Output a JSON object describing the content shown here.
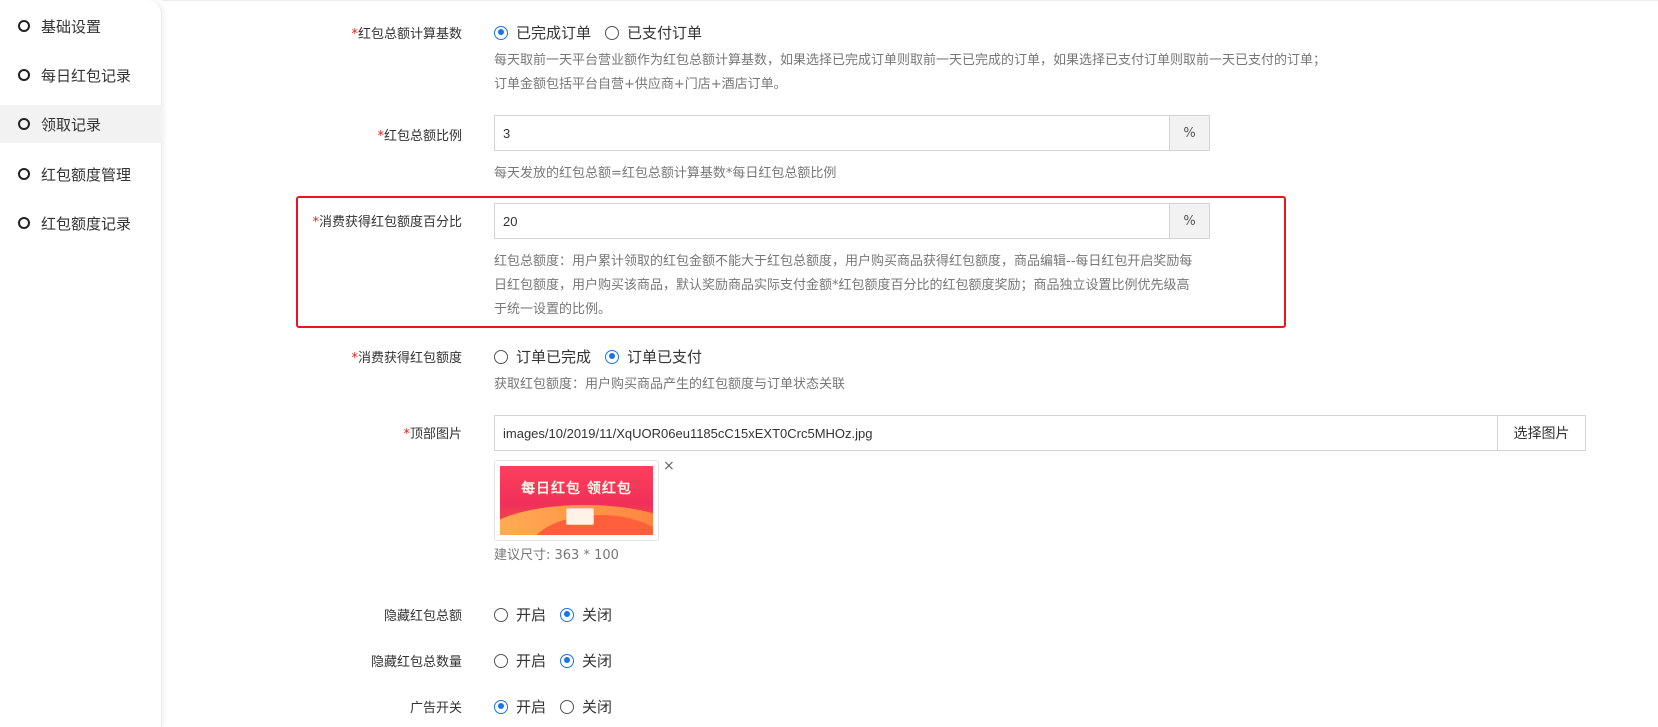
{
  "sidebar": {
    "items": [
      {
        "label": "基础设置",
        "active": false
      },
      {
        "label": "每日红包记录",
        "active": false
      },
      {
        "label": "领取记录",
        "active": true
      },
      {
        "label": "红包额度管理",
        "active": false
      },
      {
        "label": "红包额度记录",
        "active": false
      }
    ]
  },
  "form": {
    "calc_base": {
      "label": "红包总额计算基数",
      "options": [
        "已完成订单",
        "已支付订单"
      ],
      "selected": "已完成订单",
      "help_line1": "每天取前一天平台营业额作为红包总额计算基数，如果选择已完成订单则取前一天已完成的订单，如果选择已支付订单则取前一天已支付的订单；",
      "help_line2": "订单金额包括平台自营+供应商+门店+酒店订单。"
    },
    "total_ratio": {
      "label": "红包总额比例",
      "value": "3",
      "unit": "%",
      "help": "每天发放的红包总额=红包总额计算基数*每日红包总额比例"
    },
    "consume_percent": {
      "label": "消费获得红包额度百分比",
      "value": "20",
      "unit": "%",
      "help_line1": "红包总额度：用户累计领取的红包金额不能大于红包总额度，用户购买商品获得红包额度，商品编辑--每日红包开启奖励每",
      "help_line2": "日红包额度，用户购买该商品，默认奖励商品实际支付金额*红包额度百分比的红包额度奖励；商品独立设置比例优先级高",
      "help_line3": "于统一设置的比例。"
    },
    "consume_quota": {
      "label": "消费获得红包额度",
      "options": [
        "订单已完成",
        "订单已支付"
      ],
      "selected": "订单已支付",
      "help": "获取红包额度：用户购买商品产生的红包额度与订单状态关联"
    },
    "top_image": {
      "label": "顶部图片",
      "value": "images/10/2019/11/XqUOR06eu1185cC15xEXT0Crc5MHOz.jpg",
      "button": "选择图片",
      "banner_text": "每日红包  领红包",
      "remove": "×",
      "help": "建议尺寸: 363 * 100"
    },
    "hide_total": {
      "label": "隐藏红包总额",
      "options": [
        "开启",
        "关闭"
      ],
      "selected": "关闭"
    },
    "hide_count": {
      "label": "隐藏红包总数量",
      "options": [
        "开启",
        "关闭"
      ],
      "selected": "关闭"
    },
    "ad_switch": {
      "label": "广告开关",
      "options": [
        "开启",
        "关闭"
      ],
      "selected": "开启"
    }
  },
  "required_mark": "*",
  "colors": {
    "accent": "#1a73e8",
    "required": "#e2231a",
    "highlight": "#e8171d"
  }
}
